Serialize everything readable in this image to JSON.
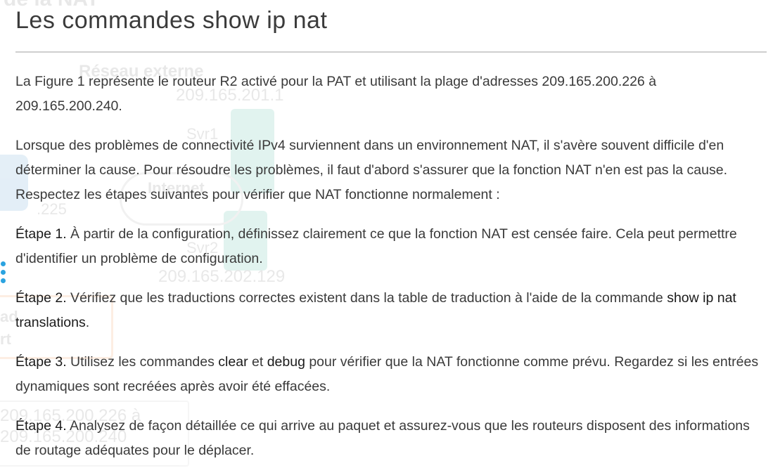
{
  "page": {
    "title": "Les commandes show ip nat"
  },
  "background_figure": {
    "header_text": "de la NAT",
    "external_network_label": "Réseau externe",
    "svr1_ip": "209.165.201.1",
    "svr1_label": "Svr1",
    "internet_label": "Internet",
    "ip_fragment": ".225",
    "svr2_label": "Svr2",
    "svr2_ip": "209.165.202.129",
    "pool_start": "209.165.200.226 à",
    "pool_end": "209.165.200.240",
    "fragment_ad": "ad",
    "fragment_rt": "rt"
  },
  "intro": {
    "p1": "La Figure 1 représente le routeur R2 activé pour la PAT et utilisant la plage d'adresses 209.165.200.226 à 209.165.200.240.",
    "p2": "Lorsque des problèmes de connectivité IPv4 surviennent dans un environnement NAT, il s'avère souvent difficile d'en déterminer la cause. Pour résoudre les problèmes, il faut d'abord s'assurer que la fonction NAT n'en est pas la cause. Respectez les étapes suivantes pour vérifier que NAT fonctionne normalement :"
  },
  "steps": [
    {
      "label": "Étape 1.",
      "text": " À partir de la configuration, définissez clairement ce que la fonction NAT est censée faire. Cela peut permettre d'identifier un problème de configuration."
    },
    {
      "label": "Étape 2.",
      "text_before": " Vérifiez que les traductions correctes existent dans la table de traduction à l'aide de la commande ",
      "command": "show ip nat translations",
      "text_after": "."
    },
    {
      "label": "Étape 3.",
      "text_before": " Utilisez les commandes ",
      "command1": "clear",
      "text_mid": " et ",
      "command2": "debug",
      "text_after": " pour vérifier que la NAT fonctionne comme prévu. Regardez si les entrées dynamiques sont recréées après avoir été effacées."
    },
    {
      "label": "Étape 4.",
      "text": " Analysez de façon détaillée ce qui arrive au paquet et assurez-vous que les routeurs disposent des informations de routage adéquates pour le déplacer."
    }
  ],
  "colors": {
    "text": "#3a3a3a",
    "divider": "#cfcfcf",
    "accent_dots": "#2ba3e0"
  }
}
